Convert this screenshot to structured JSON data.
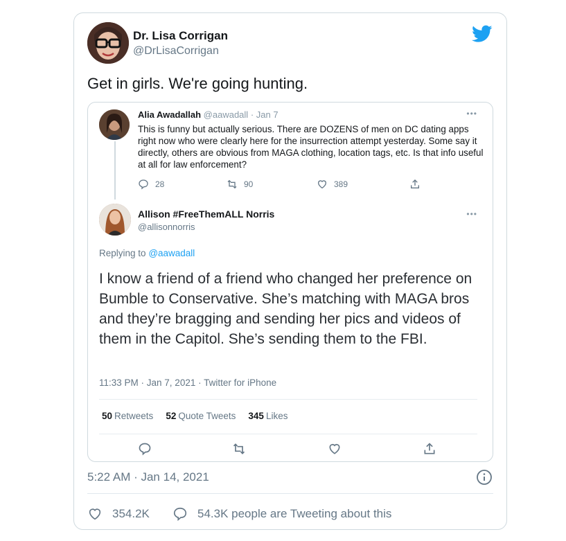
{
  "tweet": {
    "author_name": "Dr. Lisa Corrigan",
    "author_handle": "@DrLisaCorrigan",
    "text": "Get in girls. We're going hunting.",
    "timestamp": "5:22 AM · Jan 14, 2021",
    "likes": "354.2K",
    "talking": "54.3K people are Tweeting about this",
    "icons": {
      "brand": "twitter-bird-icon",
      "info": "info-icon",
      "like": "heart-icon",
      "talk": "chat-bubble-icon"
    },
    "colors": {
      "brand": "#1da1f2",
      "muted": "#657786",
      "border": "#cfd9de"
    }
  },
  "screenshot": {
    "quoted_a": {
      "name": "Alia Awadallah",
      "handle": "@aawadall",
      "date": "· Jan 7",
      "more": "•••",
      "text": "This is funny but actually serious. There are DOZENS of men on DC dating apps right now who were clearly here for the insurrection attempt yesterday. Some say it directly, others are obvious from MAGA clothing, location tags, etc. Is that info useful at all for law enforcement?",
      "replies": "28",
      "retweets": "90",
      "likes": "389"
    },
    "quoted_b": {
      "name": "Allison #FreeThemALL Norris",
      "handle": "@allisonnorris",
      "more": "•••",
      "replying_prefix": "Replying to",
      "replying_handle": "@aawadall",
      "text": "I know a friend of a friend who changed her preference on Bumble to Conservative. She’s matching with MAGA bros and they’re bragging and sending her pics and videos of them in the Capitol. She’s sending them to the FBI.",
      "timestamp": "11:33 PM · Jan 7, 2021 · Twitter for iPhone",
      "stats": {
        "retweets_count": "50",
        "retweets_label": "Retweets",
        "quotes_count": "52",
        "quotes_label": "Quote Tweets",
        "likes_count": "345",
        "likes_label": "Likes"
      }
    }
  }
}
